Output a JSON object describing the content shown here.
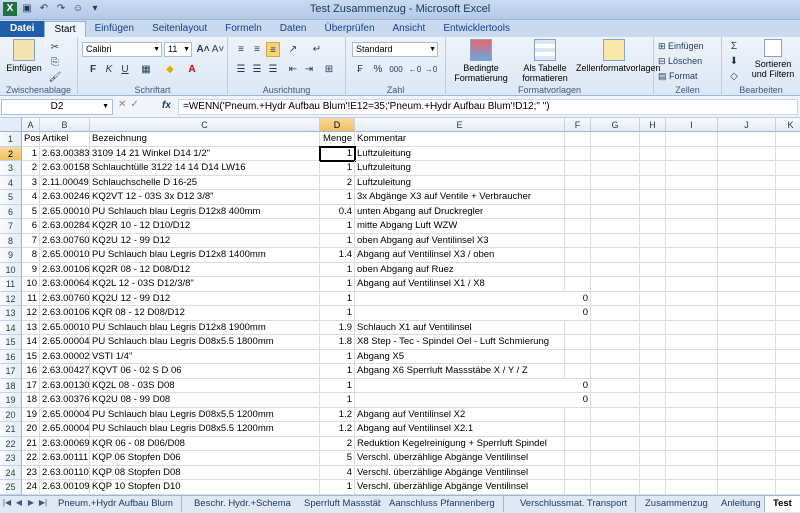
{
  "window": {
    "title": "Test Zusammenzug - Microsoft Excel"
  },
  "tabs": [
    "Datei",
    "Start",
    "Einfügen",
    "Seitenlayout",
    "Formeln",
    "Daten",
    "Überprüfen",
    "Ansicht",
    "Entwicklertools"
  ],
  "ribbon": {
    "clipboard": {
      "paste_label": "Einfügen",
      "group_label": "Zwischenablage"
    },
    "font": {
      "name": "Calibri",
      "size": "11",
      "group_label": "Schriftart",
      "bold": "F",
      "italic": "K",
      "underline": "U"
    },
    "alignment": {
      "group_label": "Ausrichtung"
    },
    "number": {
      "format": "Standard",
      "group_label": "Zahl",
      "percent": "%",
      "thousands": "000"
    },
    "styles": {
      "cond_format": "Bedingte Formatierung",
      "as_table": "Als Tabelle formatieren",
      "cell_styles": "Zellenformatvorlagen",
      "group_label": "Formatvorlagen"
    },
    "cells": {
      "insert": "Einfügen",
      "delete": "Löschen",
      "format": "Format",
      "group_label": "Zellen"
    },
    "editing": {
      "sort_filter": "Sortieren und Filtern",
      "group_label": "Bearbeiten"
    }
  },
  "formula_bar": {
    "name_box": "D2",
    "formula": "=WENN('Pneum.+Hydr Aufbau Blum'!E12=35;'Pneum.+Hydr Aufbau Blum'!D12;\" \")"
  },
  "columns": [
    "A",
    "B",
    "C",
    "D",
    "E",
    "F",
    "G",
    "H",
    "I",
    "J",
    "K"
  ],
  "rows": [
    {
      "n": "1",
      "a": "Pos",
      "b": "Artikel",
      "c": "Bezeichnung",
      "d": "Menge",
      "e": "Kommentar",
      "f": ""
    },
    {
      "n": "2",
      "a": "1",
      "b": "2.63.00383",
      "c": "3109 14 21          Winkel      D14 1/2\"",
      "d": "1",
      "e": "Luftzuleitung",
      "f": ""
    },
    {
      "n": "3",
      "a": "2",
      "b": "2.63.00158",
      "c": "Schlauchtülle 3122 14 14        D14 LW16",
      "d": "1",
      "e": "Luftzuleitung",
      "f": ""
    },
    {
      "n": "4",
      "a": "3",
      "b": "2.11.00049",
      "c": "Schlauchschelle                   D 16-25",
      "d": "2",
      "e": "Luftzuleitung",
      "f": ""
    },
    {
      "n": "5",
      "a": "4",
      "b": "2.63.00246",
      "c": "KQ2VT 12 - 03S                 3x D12  3/8\"",
      "d": "1",
      "e": "3x Abgänge X3 auf Ventile + Verbraucher",
      "f": ""
    },
    {
      "n": "6",
      "a": "5",
      "b": "2.65.00010",
      "c": "PU Schlauch blau Legris  D12x8   400mm",
      "d": "0.4",
      "e": "unten Abgang auf Druckregler",
      "f": ""
    },
    {
      "n": "7",
      "a": "6",
      "b": "2.63.00284",
      "c": "KQ2R 10 - 12                       D10/D12",
      "d": "1",
      "e": "mitte Abgang Luft WZW",
      "f": ""
    },
    {
      "n": "8",
      "a": "7",
      "b": "2.63.00760",
      "c": "KQ2U 12 - 99                      D12",
      "d": "1",
      "e": "oben Abgang auf Ventilinsel X3",
      "f": ""
    },
    {
      "n": "9",
      "a": "8",
      "b": "2.65.00010",
      "c": "PU Schlauch blau Legris  D12x8   1400mm",
      "d": "1.4",
      "e": "Abgang auf Ventilinsel X3 / oben",
      "f": ""
    },
    {
      "n": "10",
      "a": "9",
      "b": "2.63.00106",
      "c": "KQ2R 08 - 12                       D08/D12",
      "d": "1",
      "e": "oben Abgang auf Ruez",
      "f": ""
    },
    {
      "n": "11",
      "a": "10",
      "b": "2.63.00064",
      "c": "KQ2L 12 - 03S                   D12/3/8\"",
      "d": "1",
      "e": "Abgang auf Ventilinsel  X1 / X8",
      "f": ""
    },
    {
      "n": "12",
      "a": "11",
      "b": "2.63.00760",
      "c": "KQ2U 12 - 99                  D12",
      "d": "1",
      "e": "0",
      "f": ""
    },
    {
      "n": "13",
      "a": "12",
      "b": "2.63.00106",
      "c": "KQR 08 - 12                       D08/D12",
      "d": "1",
      "e": "0",
      "f": ""
    },
    {
      "n": "14",
      "a": "13",
      "b": "2.65.00010",
      "c": "PU Schlauch blau Legris  D12x8    1900mm",
      "d": "1.9",
      "e": "Schlauch X1 auf Ventilinsel",
      "f": ""
    },
    {
      "n": "15",
      "a": "14",
      "b": "2.65.00004",
      "c": "PU Schlauch blau Legris  D08x5.5 1800mm",
      "d": "1.8",
      "e": "X8 Step - Tec - Spindel Oel - Luft Schmierung",
      "f": ""
    },
    {
      "n": "16",
      "a": "15",
      "b": "2.63.00002",
      "c": "VSTI 1/4\"",
      "d": "1",
      "e": "Abgang X5",
      "f": ""
    },
    {
      "n": "17",
      "a": "16",
      "b": "2.63.00427",
      "c": "KQVT 06 - 02 S                  D 06",
      "d": "1",
      "e": "Abgang X6  Sperrluft Massstäbe X / Y / Z",
      "f": ""
    },
    {
      "n": "18",
      "a": "17",
      "b": "2.63.00130",
      "c": "KQ2L  08 - 03S                D08",
      "d": "1",
      "e": "0",
      "f": ""
    },
    {
      "n": "19",
      "a": "18",
      "b": "2.63.00376",
      "c": "KQ2U  08 - 99                  D08",
      "d": "1",
      "e": "0",
      "f": ""
    },
    {
      "n": "20",
      "a": "19",
      "b": "2.65.00004",
      "c": "PU Schlauch blau Legris D08x5.5 1200mm",
      "d": "1.2",
      "e": "Abgang auf Ventilinsel  X2",
      "f": ""
    },
    {
      "n": "21",
      "a": "20",
      "b": "2.65.00004",
      "c": "PU Schlauch blau Legris D08x5.5 1200mm",
      "d": "1.2",
      "e": "Abgang auf Ventilinsel  X2.1",
      "f": ""
    },
    {
      "n": "22",
      "a": "21",
      "b": "2.63.00069",
      "c": "KQR 06 - 08                 D06/D08",
      "d": "2",
      "e": "Reduktion Kegelreinigung + Sperrluft Spindel",
      "f": ""
    },
    {
      "n": "23",
      "a": "22",
      "b": "2.63.00111",
      "c": "KQP 06                   Stopfen D06",
      "d": "5",
      "e": "Verschl. überzählige Abgänge Ventilinsel",
      "f": ""
    },
    {
      "n": "24",
      "a": "23",
      "b": "2.63.00110",
      "c": "KQP 08                   Stopfen D08",
      "d": "4",
      "e": "Verschl. überzählige Abgänge Ventilinsel",
      "f": ""
    },
    {
      "n": "25",
      "a": "24",
      "b": "2.63.00109",
      "c": "KQP 10                   Stopfen D10",
      "d": "1",
      "e": "Verschl. überzählige Abgänge Ventilinsel",
      "f": ""
    }
  ],
  "sheets": [
    "Pneum.+Hydr Aufbau Blum",
    "Beschr. Hydr.+Schema",
    "Sperrluft Massstäbe",
    "Aanschluss Pfannenberg",
    "Verschlussmat. Transport",
    "Zusammenzug",
    "Anleitung",
    "Test"
  ],
  "active_sheet": "Test"
}
